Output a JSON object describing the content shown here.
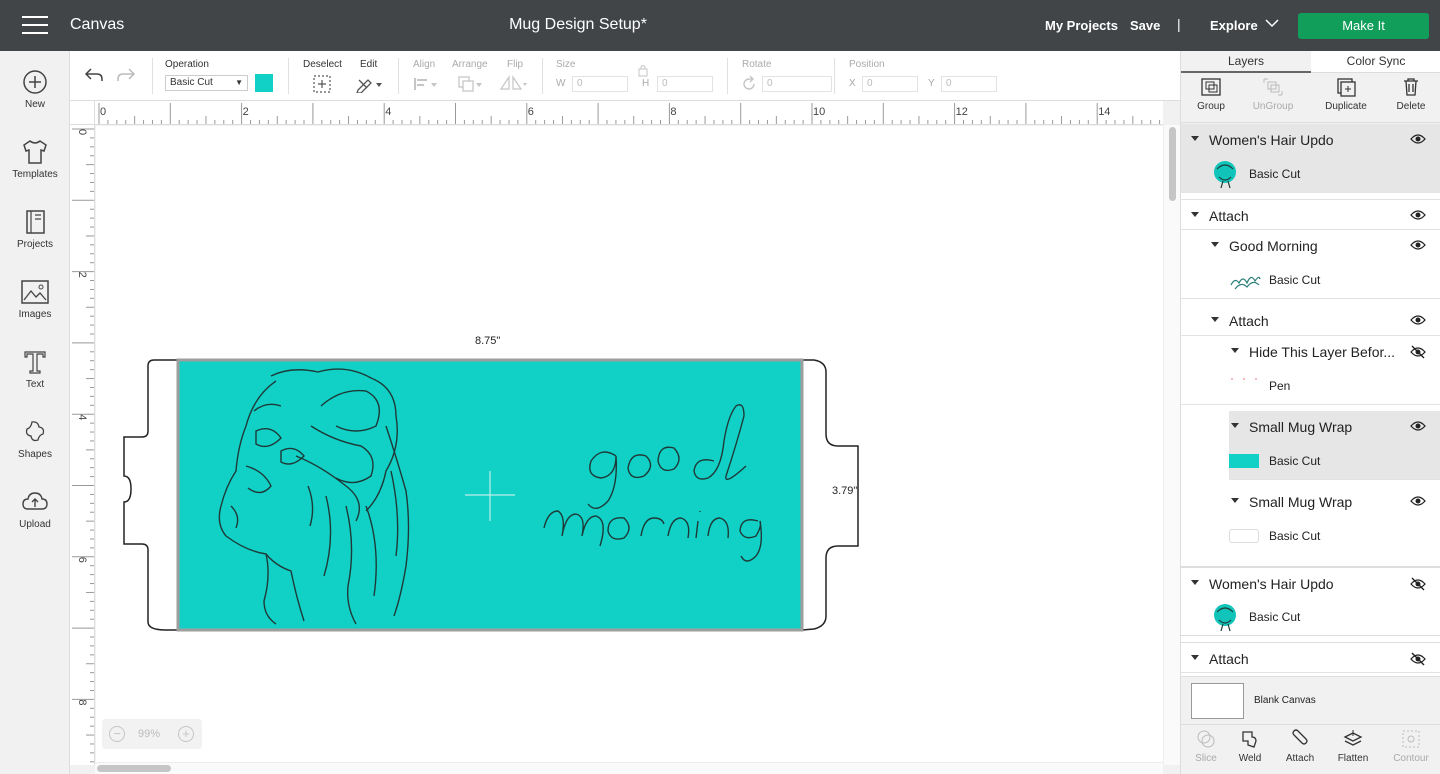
{
  "topbar": {
    "app_title": "Canvas",
    "doc_title": "Mug Design Setup*",
    "my_projects": "My Projects",
    "save": "Save",
    "separator": "|",
    "explore": "Explore",
    "make_it": "Make It"
  },
  "leftbar": {
    "items": [
      {
        "label": "New",
        "icon": "plus-circle-icon"
      },
      {
        "label": "Templates",
        "icon": "tshirt-icon"
      },
      {
        "label": "Projects",
        "icon": "book-icon"
      },
      {
        "label": "Images",
        "icon": "image-icon"
      },
      {
        "label": "Text",
        "icon": "text-icon"
      },
      {
        "label": "Shapes",
        "icon": "shapes-icon"
      },
      {
        "label": "Upload",
        "icon": "upload-cloud-icon"
      }
    ]
  },
  "toolbar": {
    "operation_label": "Operation",
    "operation_value": "Basic Cut",
    "operation_color": "#11d1c6",
    "deselect": "Deselect",
    "edit": "Edit",
    "align": "Align",
    "arrange": "Arrange",
    "flip": "Flip",
    "size": "Size",
    "w": "W",
    "w_value": "0",
    "h": "H",
    "h_value": "0",
    "rotate": "Rotate",
    "rotate_value": "0",
    "position": "Position",
    "x": "X",
    "x_value": "0",
    "y": "Y",
    "y_value": "0"
  },
  "ruler": {
    "top_ticks": [
      "0",
      "2",
      "4",
      "6",
      "8",
      "10",
      "12",
      "14"
    ],
    "left_ticks": [
      "0",
      "2",
      "4",
      "6",
      "8"
    ]
  },
  "canvas": {
    "width_label": "8.75\"",
    "height_label": "3.79\"",
    "zoom": "99%",
    "zoom_minus": "−",
    "zoom_plus": "+",
    "wrap_color": "#11d1c6"
  },
  "rightpanel": {
    "tabs": {
      "layers": "Layers",
      "color_sync": "Color Sync"
    },
    "actions": {
      "group": "Group",
      "ungroup": "UnGroup",
      "duplicate": "Duplicate",
      "delete": "Delete"
    },
    "layers": [
      {
        "name": "Women's Hair Updo",
        "sub": "Basic Cut",
        "visible": true
      },
      {
        "name": "Attach",
        "visible": true
      },
      {
        "name": "Good Morning",
        "sub": "Basic Cut",
        "visible": true
      },
      {
        "name": "Attach",
        "visible": true
      },
      {
        "name": "Hide This Layer Befor...",
        "sub": "Pen",
        "visible": false
      },
      {
        "name": "Small Mug Wrap",
        "sub": "Basic Cut",
        "visible": true
      },
      {
        "name": "Small Mug Wrap",
        "sub": "Basic Cut",
        "visible": true
      },
      {
        "name": "Women's Hair Updo",
        "sub": "Basic Cut",
        "visible": false
      },
      {
        "name": "Attach",
        "visible": false
      }
    ],
    "blank_canvas": "Blank Canvas",
    "tools": {
      "slice": "Slice",
      "weld": "Weld",
      "attach": "Attach",
      "flatten": "Flatten",
      "contour": "Contour"
    }
  }
}
